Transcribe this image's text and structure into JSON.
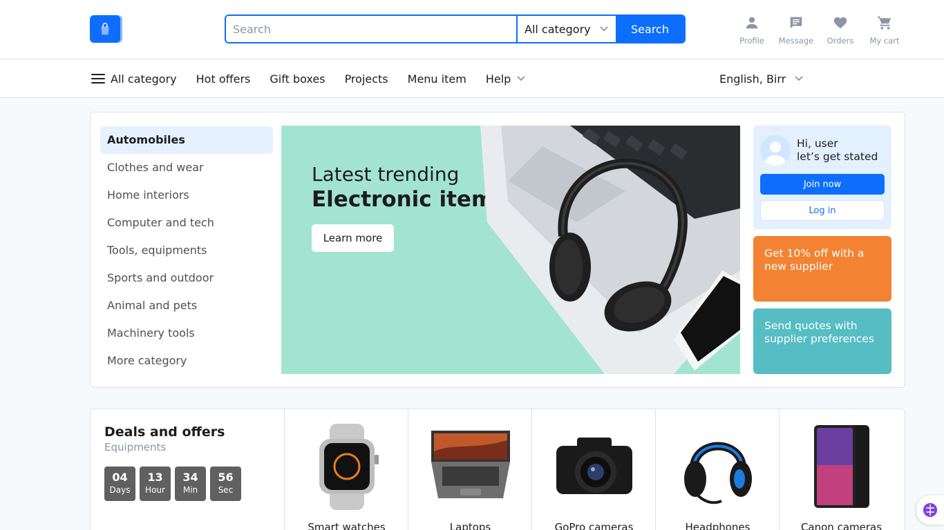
{
  "header": {
    "search_placeholder": "Search",
    "category_select": "All category",
    "search_button": "Search",
    "actions": [
      {
        "label": "Profile",
        "icon": "person-icon"
      },
      {
        "label": "Message",
        "icon": "message-icon"
      },
      {
        "label": "Orders",
        "icon": "heart-icon"
      },
      {
        "label": "My cart",
        "icon": "cart-icon"
      }
    ]
  },
  "nav": {
    "items": [
      "All category",
      "Hot offers",
      "Gift boxes",
      "Projects",
      "Menu item",
      "Help"
    ],
    "locale": "English, Birr"
  },
  "categories": [
    "Automobiles",
    "Clothes and wear",
    "Home interiors",
    "Computer and tech",
    "Tools, equipments",
    "Sports and outdoor",
    "Animal and pets",
    "Machinery tools",
    "More category"
  ],
  "banner": {
    "line1": "Latest trending",
    "line2": "Electronic items",
    "button": "Learn more"
  },
  "user_box": {
    "greeting_line1": "Hi, user",
    "greeting_line2": "let’s get stated",
    "join_button": "Join now",
    "login_button": "Log in"
  },
  "promos": [
    {
      "text": "Get 10% off with a new supplier",
      "color": "#F38332"
    },
    {
      "text": "Send quotes with supplier preferences",
      "color": "#55BDC3"
    }
  ],
  "deals": {
    "title": "Deals and offers",
    "subtitle": "Equipments",
    "timer": [
      {
        "value": "04",
        "unit": "Days"
      },
      {
        "value": "13",
        "unit": "Hour"
      },
      {
        "value": "34",
        "unit": "Min"
      },
      {
        "value": "56",
        "unit": "Sec"
      }
    ],
    "products": [
      "Smart watches",
      "Laptops",
      "GoPro cameras",
      "Headphones",
      "Canon cameras"
    ]
  },
  "colors": {
    "primary": "#0D6EFD",
    "banner_bg": "#A3E4D0",
    "active_category_bg": "#E5F1FF"
  }
}
